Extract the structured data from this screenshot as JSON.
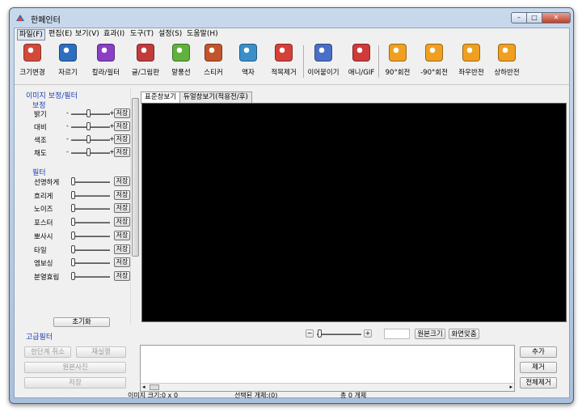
{
  "window": {
    "title": "한페인터",
    "minimize": "–",
    "maximize": "□",
    "close": "✕"
  },
  "menu": [
    "파일(F)",
    "편집(E)",
    "보기(V)",
    "효과(I)",
    "도구(T)",
    "설정(S)",
    "도움말(H)"
  ],
  "toolbar": [
    {
      "label": "크기변경",
      "icon": "resize-icon",
      "color": "#d34a3a"
    },
    {
      "label": "자르기",
      "icon": "crop-icon",
      "color": "#2c6fbf"
    },
    {
      "label": "칼라/필터",
      "icon": "color-filter-icon",
      "color": "#8a3fc4"
    },
    {
      "label": "글/그림판",
      "icon": "text-paint-icon",
      "color": "#c23b3b"
    },
    {
      "label": "말풍선",
      "icon": "speech-bubble-icon",
      "color": "#5fb23c"
    },
    {
      "label": "스티커",
      "icon": "sticker-icon",
      "color": "#c2552b"
    },
    {
      "label": "액자",
      "icon": "frame-icon",
      "color": "#3a8fc9"
    },
    {
      "label": "적목제거",
      "icon": "red-eye-icon",
      "color": "#d6403a"
    },
    {
      "label": "이어붙이기",
      "icon": "merge-icon",
      "color": "#4a6fc6"
    },
    {
      "label": "애니/GIF",
      "icon": "gif-icon",
      "color": "#d03a3a"
    },
    {
      "label": "90°회전",
      "icon": "rotate-cw-icon",
      "color": "#f0a020"
    },
    {
      "label": "-90°회전",
      "icon": "rotate-ccw-icon",
      "color": "#f0a020"
    },
    {
      "label": "좌우반전",
      "icon": "flip-horizontal-icon",
      "color": "#f0a020"
    },
    {
      "label": "상하반전",
      "icon": "flip-vertical-icon",
      "color": "#f0a020"
    }
  ],
  "panel": {
    "section_title": "이미지 보정/필터",
    "correction_title": "보정",
    "correction_rows": [
      {
        "label": "밝기"
      },
      {
        "label": "대비"
      },
      {
        "label": "색조"
      },
      {
        "label": "채도"
      }
    ],
    "minus": "-",
    "plus": "+",
    "filter_title": "필터",
    "filter_rows": [
      {
        "label": "선명하게"
      },
      {
        "label": "흐리게"
      },
      {
        "label": "노이즈"
      },
      {
        "label": "포스터"
      },
      {
        "label": "뽀사시"
      },
      {
        "label": "타일"
      },
      {
        "label": "엠보싱"
      },
      {
        "label": "분열효림"
      }
    ],
    "save_label": "저장",
    "reset_label": "초기화",
    "advanced_title": "고급필터"
  },
  "left_buttons": {
    "undo": "한단계 취소",
    "redo": "재실행",
    "original": "원본사진",
    "save": "저장"
  },
  "tabs": [
    "표준창보기",
    "듀얼창보기(적용전/후)"
  ],
  "zoom": {
    "minus": "−",
    "plus": "+",
    "value": "",
    "original_size": "원본크기",
    "fit_screen": "화면맞춤"
  },
  "right_buttons": {
    "add": "추가",
    "remove": "제거",
    "remove_all": "전체제거"
  },
  "status": {
    "image_size": "이미지 크기:0 x 0",
    "selected": "선택된 개체:(0)",
    "total": "총 0 개체"
  }
}
